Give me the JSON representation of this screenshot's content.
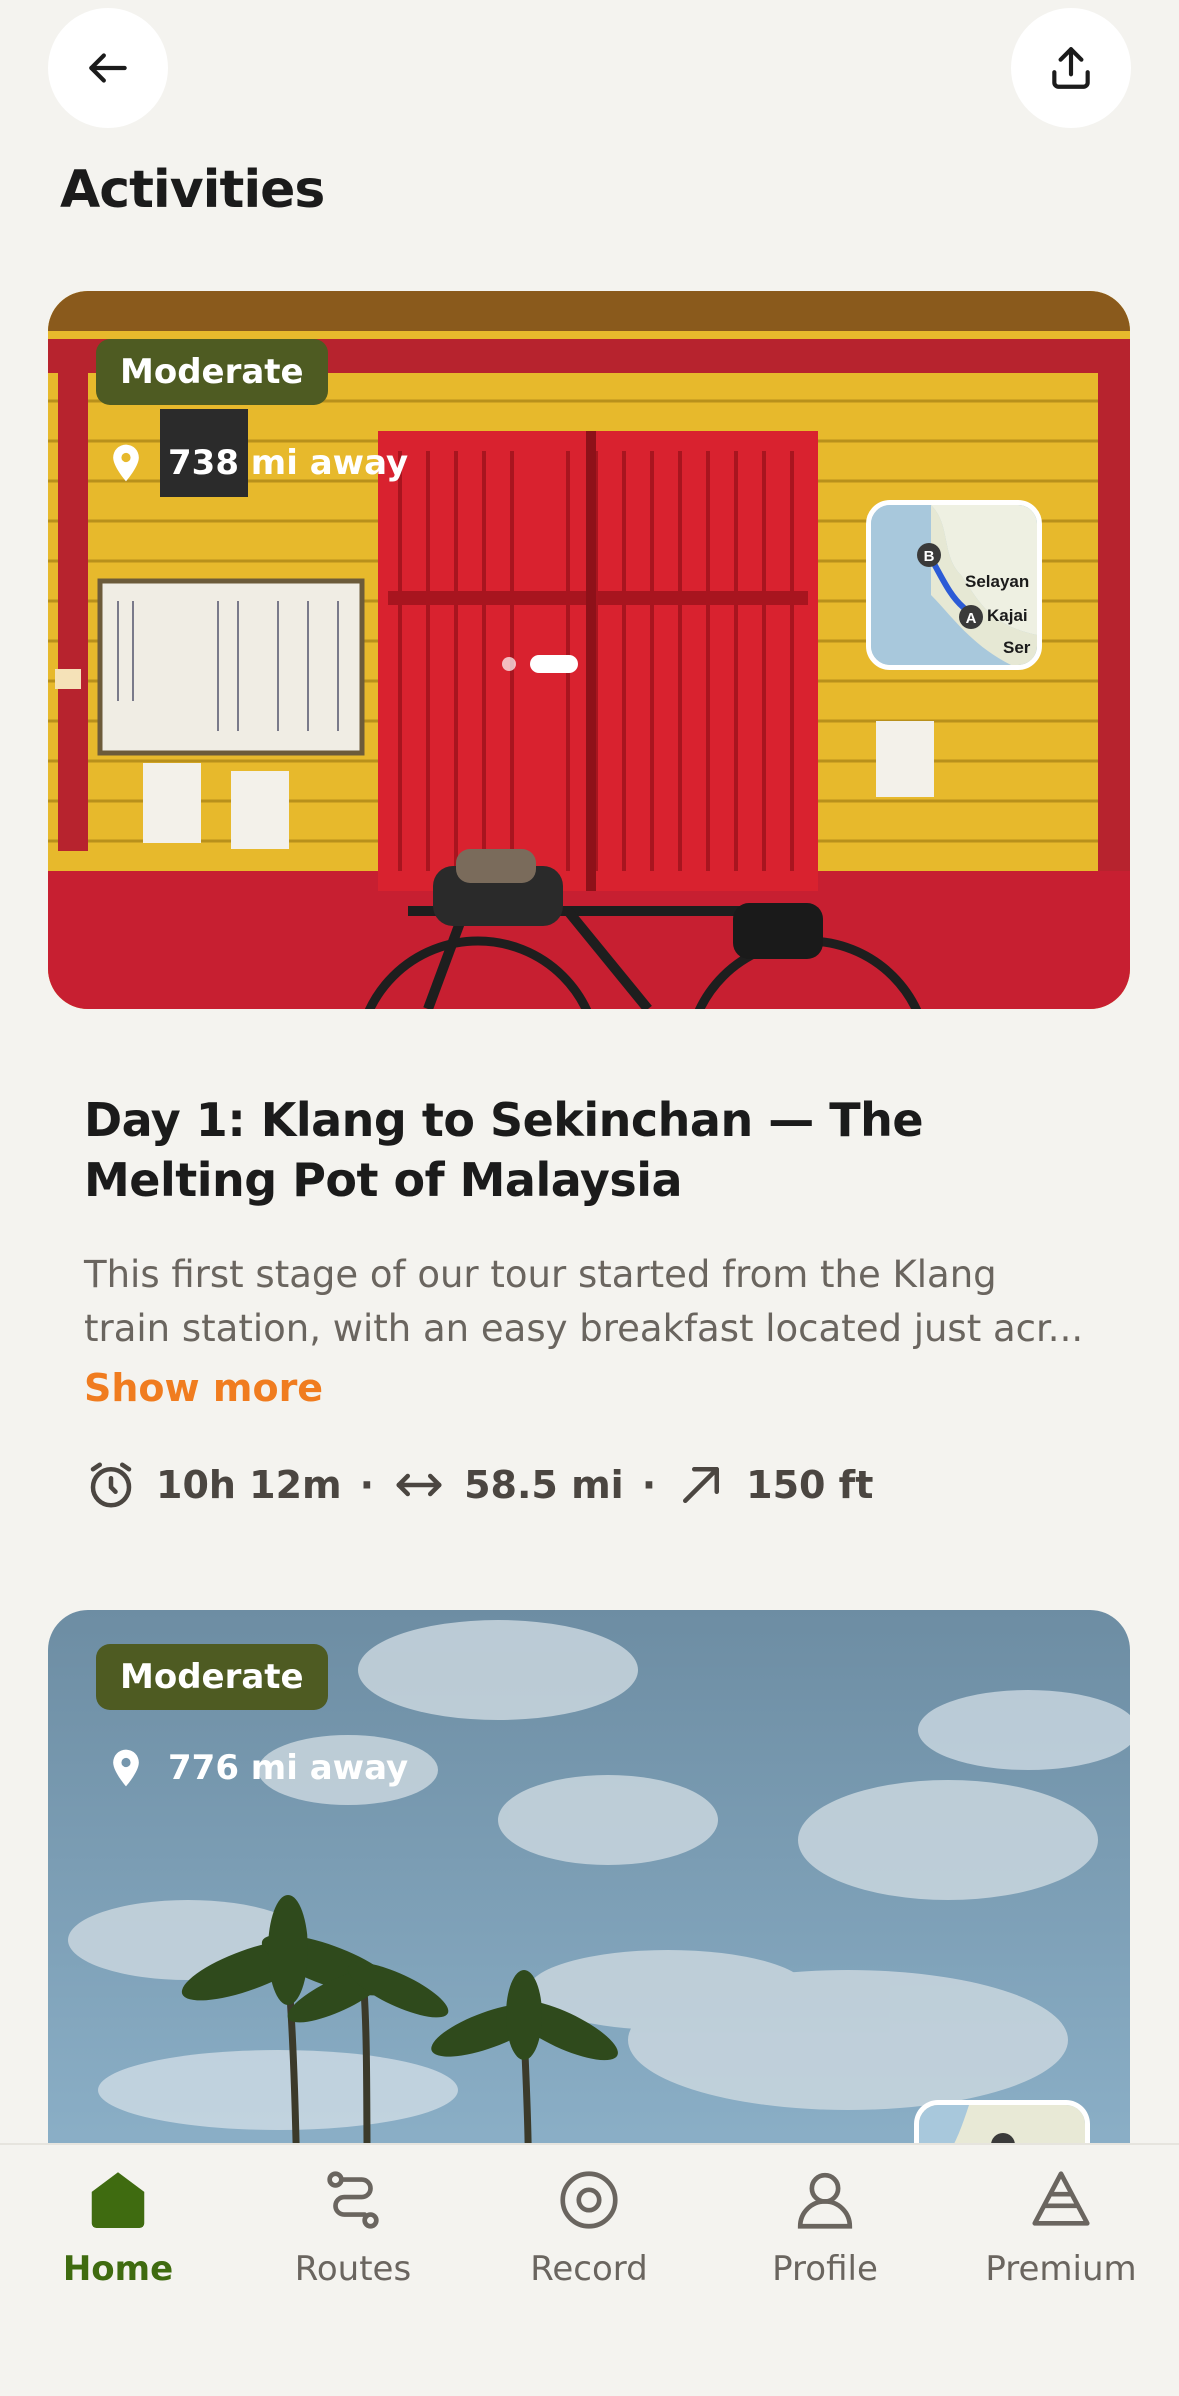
{
  "header": {
    "back_icon": "arrow-left-icon",
    "share_icon": "share-upload-icon",
    "title": "Activities"
  },
  "activities": [
    {
      "difficulty": "Moderate",
      "distance_away": "738 mi away",
      "map_labels": [
        "B",
        "A",
        "Selayan",
        "Kajai",
        "Ser"
      ],
      "title": "Day 1: Klang to Sekinchan — The Melting Pot of Malaysia",
      "description": "This first stage of our tour started from the Klang train station, with an easy breakfast located just acr...",
      "show_more": "Show more",
      "stats": {
        "duration": "10h 12m",
        "distance": "58.5 mi",
        "elevation": "150 ft",
        "separator": "·"
      }
    },
    {
      "difficulty": "Moderate",
      "distance_away": "776 mi away"
    }
  ],
  "tabbar": {
    "items": [
      {
        "label": "Home",
        "icon": "home-icon",
        "active": true
      },
      {
        "label": "Routes",
        "icon": "routes-icon",
        "active": false
      },
      {
        "label": "Record",
        "icon": "record-icon",
        "active": false
      },
      {
        "label": "Profile",
        "icon": "profile-icon",
        "active": false
      },
      {
        "label": "Premium",
        "icon": "premium-icon",
        "active": false
      }
    ]
  },
  "colors": {
    "background": "#f4f3ef",
    "badge": "#4e5b22",
    "accent_orange": "#f07c1f",
    "active_tab": "#3f6b10"
  }
}
